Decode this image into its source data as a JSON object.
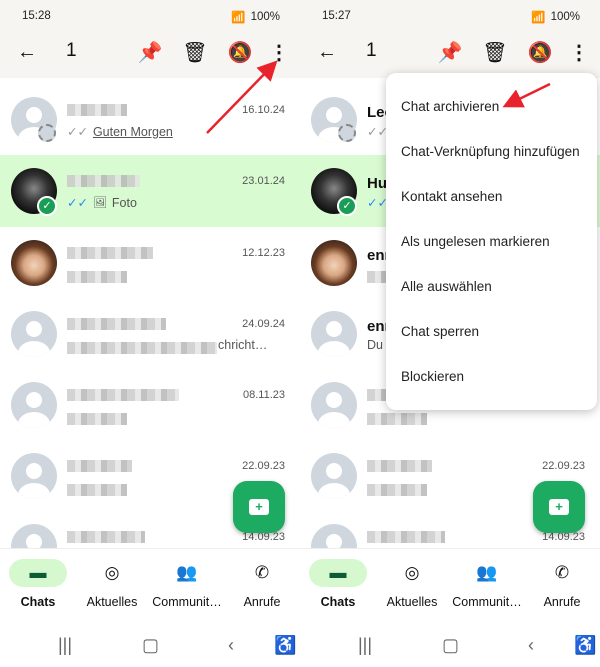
{
  "accent": "#1daa61",
  "selection_color": "#d9fbd2",
  "arrow_color": "#e8232b",
  "panels": [
    {
      "status": {
        "time": "15:28",
        "battery": "100%"
      },
      "toolbar": {
        "count": "1",
        "icons": [
          "back-arrow-icon",
          "pin-icon",
          "trash-icon",
          "bell-off-icon",
          "more-vert-icon"
        ]
      },
      "rows": [
        {
          "name": "",
          "date": "16.10.24",
          "preview": "Guten Morgen",
          "ticks": "✓✓"
        },
        {
          "name": "",
          "date": "23.01.24",
          "preview": "Foto",
          "ticks": "✓✓",
          "selected": true
        },
        {
          "name": "",
          "date": "12.12.23",
          "preview": ""
        },
        {
          "name": "",
          "date": "24.09.24",
          "preview": "chricht…"
        },
        {
          "name": "",
          "date": "08.11.23",
          "preview": ""
        },
        {
          "name": "",
          "date": "22.09.23",
          "preview": ""
        },
        {
          "name": "",
          "date": "14.09.23",
          "preview": ""
        }
      ],
      "nav": [
        {
          "label": "Chats"
        },
        {
          "label": "Aktuelles"
        },
        {
          "label": "Communit…"
        },
        {
          "label": "Anrufe"
        }
      ]
    },
    {
      "status": {
        "time": "15:27",
        "battery": "100%"
      },
      "toolbar": {
        "count": "1",
        "icons": [
          "back-arrow-icon",
          "pin-icon",
          "trash-icon",
          "bell-off-icon",
          "more-vert-icon"
        ]
      },
      "rows": [
        {
          "name": "Leo",
          "date": "",
          "preview": "",
          "ticks": "✓✓"
        },
        {
          "name": "Hu",
          "date": "",
          "preview": "",
          "ticks": "✓✓",
          "selected": true
        },
        {
          "name": "enn",
          "date": "",
          "preview": ""
        },
        {
          "name": "enn",
          "date": "",
          "preview": "Du"
        },
        {
          "name": "",
          "date": "",
          "preview": ""
        },
        {
          "name": "",
          "date": "22.09.23",
          "preview": ""
        },
        {
          "name": "",
          "date": "14.09.23",
          "preview": ""
        }
      ],
      "menu": [
        "Chat archivieren",
        "Chat-Verknüpfung hinzufügen",
        "Kontakt ansehen",
        "Als ungelesen markieren",
        "Alle auswählen",
        "Chat sperren",
        "Blockieren"
      ],
      "nav": [
        {
          "label": "Chats"
        },
        {
          "label": "Aktuelles"
        },
        {
          "label": "Communit…"
        },
        {
          "label": "Anrufe"
        }
      ]
    }
  ]
}
